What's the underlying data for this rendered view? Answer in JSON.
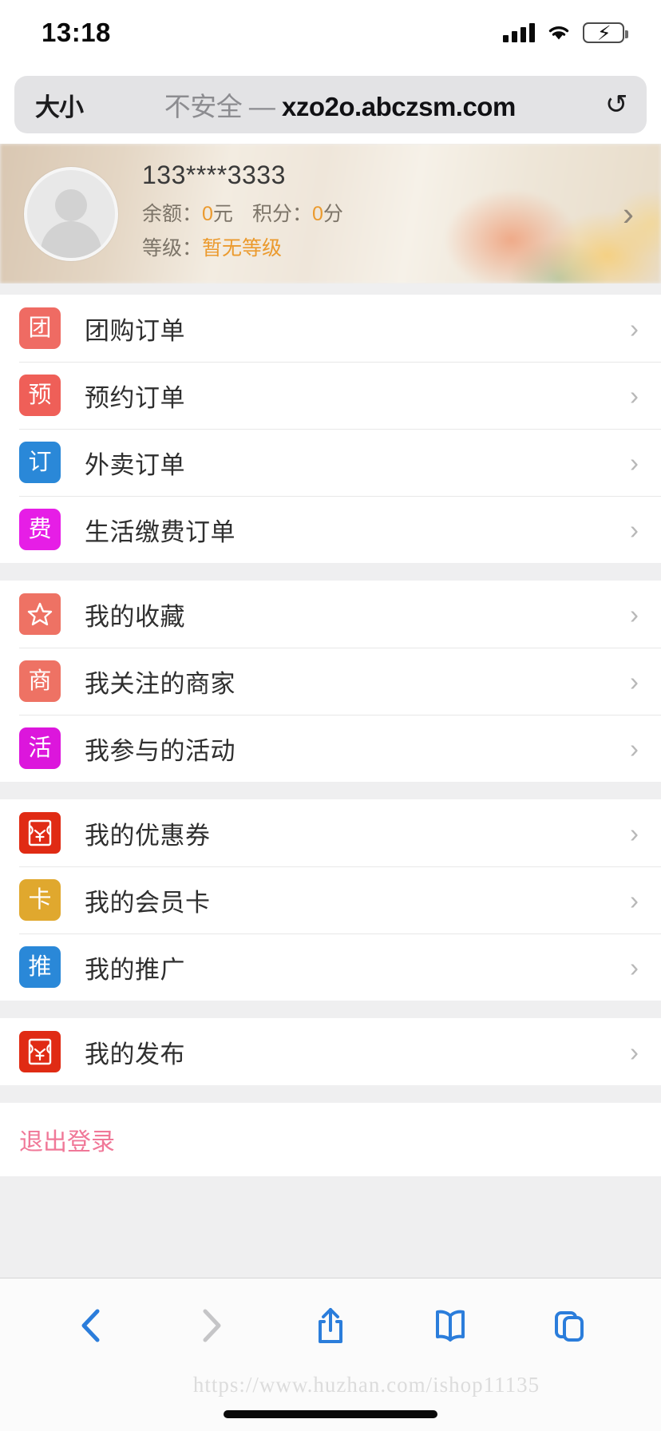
{
  "status_bar": {
    "time": "13:18",
    "signal_icon": "cellular-signal-icon",
    "wifi_icon": "wifi-icon",
    "battery_icon": "battery-charging-icon"
  },
  "browser": {
    "text_size_label": "大小",
    "security_label": "不安全",
    "separator": "—",
    "host": "xzo2o.abczsm.com",
    "reload_glyph": "↻"
  },
  "profile": {
    "phone": "133****3333",
    "balance_label": "余额：",
    "balance_value": "0",
    "balance_unit": "元",
    "points_label": "积分：",
    "points_value": "0",
    "points_unit": "分",
    "level_label": "等级：",
    "level_value": "暂无等级",
    "arrow": "›",
    "accent_color": "#eb9a2e"
  },
  "groups": [
    {
      "name": "orders",
      "items": [
        {
          "badge_text": "团",
          "badge_color": "#ef6b63",
          "label": "团购订单",
          "icon": "group-buy-icon",
          "arrow": "›"
        },
        {
          "badge_text": "预",
          "badge_color": "#ef5f58",
          "label": "预约订单",
          "icon": "reservation-icon",
          "arrow": "›"
        },
        {
          "badge_text": "订",
          "badge_color": "#2a88d8",
          "label": "外卖订单",
          "icon": "takeout-order-icon",
          "arrow": "›"
        },
        {
          "badge_text": "费",
          "badge_color": "#e61ee6",
          "label": "生活缴费订单",
          "icon": "utility-payment-icon",
          "arrow": "›"
        }
      ]
    },
    {
      "name": "favorites",
      "items": [
        {
          "badge_text": "",
          "badge_icon": "star-icon",
          "badge_color": "#ee7264",
          "label": "我的收藏",
          "icon": "my-favorites-icon",
          "arrow": "›"
        },
        {
          "badge_text": "商",
          "badge_color": "#ee7264",
          "label": "我关注的商家",
          "icon": "followed-merchants-icon",
          "arrow": "›"
        },
        {
          "badge_text": "活",
          "badge_color": "#dc16dc",
          "label": "我参与的活动",
          "icon": "my-activities-icon",
          "arrow": "›"
        }
      ]
    },
    {
      "name": "wallet",
      "items": [
        {
          "badge_text": "",
          "badge_icon": "coupon-icon",
          "badge_color": "#e02b14",
          "label": "我的优惠券",
          "icon": "my-coupons-icon",
          "arrow": "›"
        },
        {
          "badge_text": "卡",
          "badge_color": "#e0a82e",
          "label": "我的会员卡",
          "icon": "membership-card-icon",
          "arrow": "›"
        },
        {
          "badge_text": "推",
          "badge_color": "#2a88d8",
          "label": "我的推广",
          "icon": "my-promotion-icon",
          "arrow": "›"
        }
      ]
    },
    {
      "name": "publish",
      "items": [
        {
          "badge_text": "",
          "badge_icon": "coupon-icon",
          "badge_color": "#e02b14",
          "label": "我的发布",
          "icon": "my-posts-icon",
          "arrow": "›"
        }
      ]
    }
  ],
  "logout": {
    "label": "退出登录",
    "color": "#f07898"
  },
  "toolbar": {
    "back_icon": "chevron-left-icon",
    "forward_icon": "chevron-right-icon",
    "share_icon": "share-icon",
    "bookmarks_icon": "book-icon",
    "tabs_icon": "tabs-icon",
    "watermark": "https://www.huzhan.com/ishop11135",
    "active_color": "#2b7ddb",
    "disabled_color": "#c5c5c7"
  }
}
